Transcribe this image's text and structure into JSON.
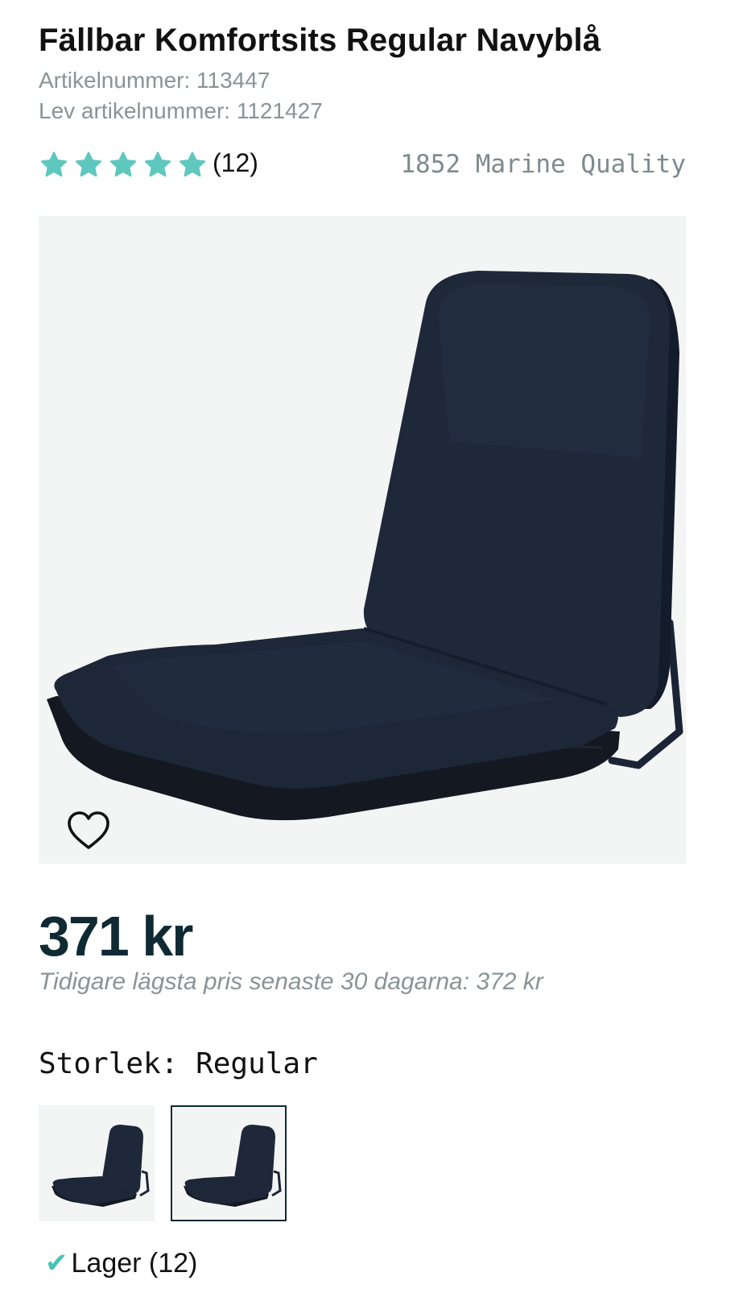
{
  "product": {
    "title": "Fällbar Komfortsits Regular Navyblå",
    "article_number": "Artikelnummer: 113447",
    "supplier_article_number": "Lev artikelnummer: 1121427",
    "rating": 5,
    "rating_max": 5,
    "review_count": "(12)",
    "brand": "1852 Marine Quality"
  },
  "pricing": {
    "price": "371 kr",
    "previous_lowest": "Tidigare lägsta pris senaste 30 dagarna: 372 kr"
  },
  "size": {
    "label": "Storlek: Regular",
    "selected_variant_index": 1
  },
  "stock": {
    "text": "Lager (12)"
  },
  "colors": {
    "star": "#5ec8bf",
    "seat": "#1e2738",
    "price": "#0f2a33",
    "image_bg": "#f3f5f5"
  },
  "icons": {
    "favorite": "heart-icon",
    "star": "star-icon",
    "stock": "check-icon"
  }
}
